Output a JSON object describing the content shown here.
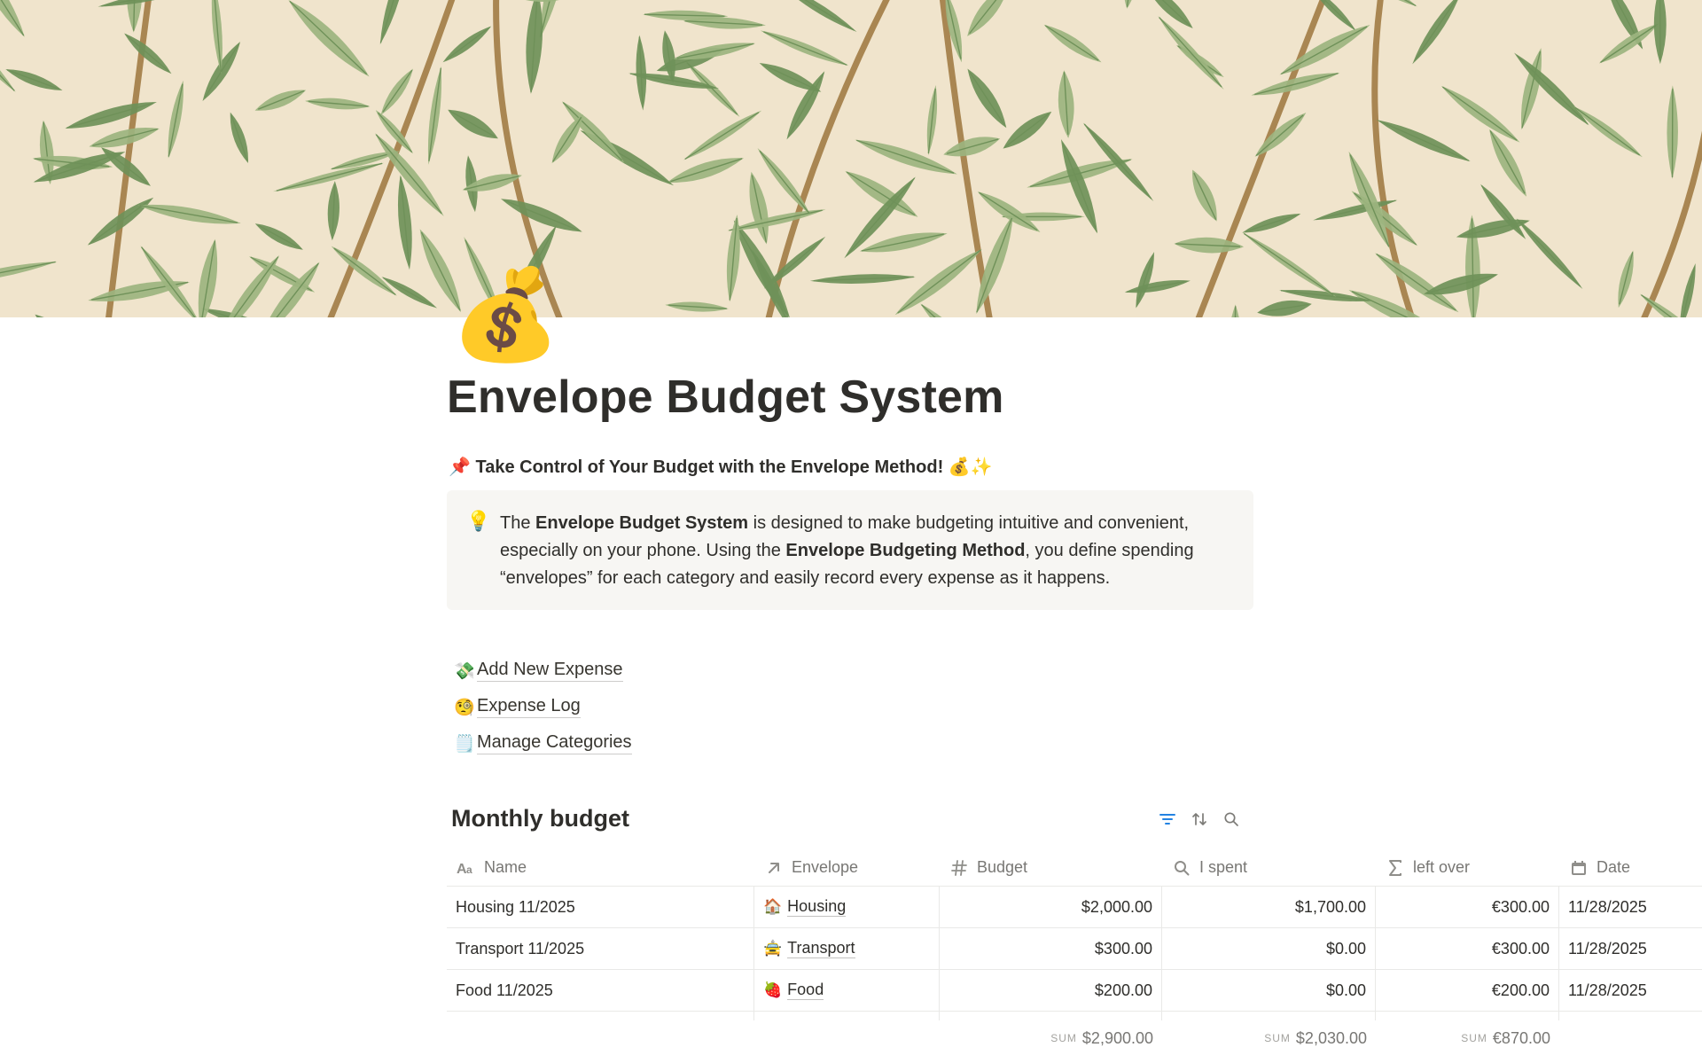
{
  "page": {
    "icon": "money-bag-icon",
    "icon_glyph": "💰",
    "title": "Envelope Budget System",
    "headline_emoji": "📌",
    "headline": "Take Control of Your Budget with the Envelope Method!",
    "headline_tail": "💰✨"
  },
  "callout": {
    "icon": "lightbulb-icon",
    "icon_glyph": "💡",
    "t1": "The ",
    "b1": "Envelope Budget System",
    "t2": " is designed to make budgeting intuitive and convenient, especially on your phone. Using the ",
    "b2": "Envelope Budgeting Method",
    "t3": ", you define spending “envelopes” for each category and easily record every expense as it happens."
  },
  "links": [
    {
      "emoji": "💸",
      "label": "Add New Expense"
    },
    {
      "emoji": "🧐",
      "label": "Expense Log"
    },
    {
      "emoji": "🗒️",
      "label": "Manage Categories"
    }
  ],
  "database": {
    "title": "Monthly budget",
    "tools": [
      "filter-icon",
      "sort-icon",
      "search-icon"
    ],
    "columns": [
      {
        "label": "Name",
        "icon": "text-property-icon"
      },
      {
        "label": "Envelope",
        "icon": "relation-arrow-icon"
      },
      {
        "label": "Budget",
        "icon": "number-hash-icon"
      },
      {
        "label": "I spent",
        "icon": "rollup-search-icon"
      },
      {
        "label": "left over",
        "icon": "formula-sigma-icon"
      },
      {
        "label": "Date",
        "icon": "calendar-icon"
      }
    ],
    "rows": [
      {
        "name": "Housing 11/2025",
        "envelope_emoji": "🏠",
        "envelope": "Housing",
        "budget": "$2,000.00",
        "spent": "$1,700.00",
        "left": "€300.00",
        "date": "11/28/2025"
      },
      {
        "name": "Transport 11/2025",
        "envelope_emoji": "🚖",
        "envelope": "Transport",
        "budget": "$300.00",
        "spent": "$0.00",
        "left": "€300.00",
        "date": "11/28/2025"
      },
      {
        "name": "Food 11/2025",
        "envelope_emoji": "🍓",
        "envelope": "Food",
        "budget": "$200.00",
        "spent": "$0.00",
        "left": "€200.00",
        "date": "11/28/2025"
      }
    ],
    "footer": {
      "sum_label": "SUM",
      "budget_sum": "$2,900.00",
      "spent_sum": "$2,030.00",
      "left_sum": "€870.00"
    }
  },
  "colors": {
    "cover_bg": "#f0e4cc",
    "leaf": "#9cb47f",
    "leaf_dark": "#6f9159",
    "branch": "#a98652",
    "callout_bg": "#f7f6f3",
    "accent_blue": "#2383e2"
  }
}
